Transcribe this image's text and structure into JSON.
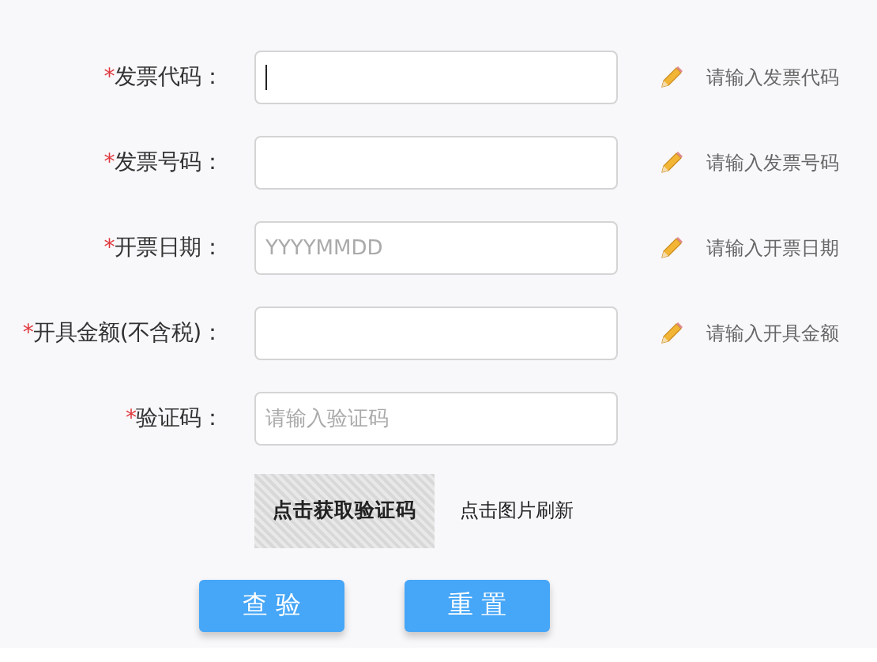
{
  "fields": [
    {
      "required_mark": "*",
      "label": "发票代码：",
      "focused": true,
      "hint": "请输入发票代码"
    },
    {
      "required_mark": "*",
      "label": "发票号码：",
      "focused": false,
      "hint": "请输入发票号码"
    },
    {
      "required_mark": "*",
      "label": "开票日期：",
      "placeholder": "YYYYMMDD",
      "focused": false,
      "hint": "请输入开票日期"
    },
    {
      "required_mark": "*",
      "label": "开具金额(不含税)：",
      "focused": false,
      "hint": "请输入开具金额"
    },
    {
      "required_mark": "*",
      "label": "验证码：",
      "placeholder": "请输入验证码",
      "focused": false
    }
  ],
  "captcha": {
    "text": "点击获取验证码",
    "refresh_hint": "点击图片刷新"
  },
  "buttons": [
    "查 验",
    "重 置"
  ]
}
